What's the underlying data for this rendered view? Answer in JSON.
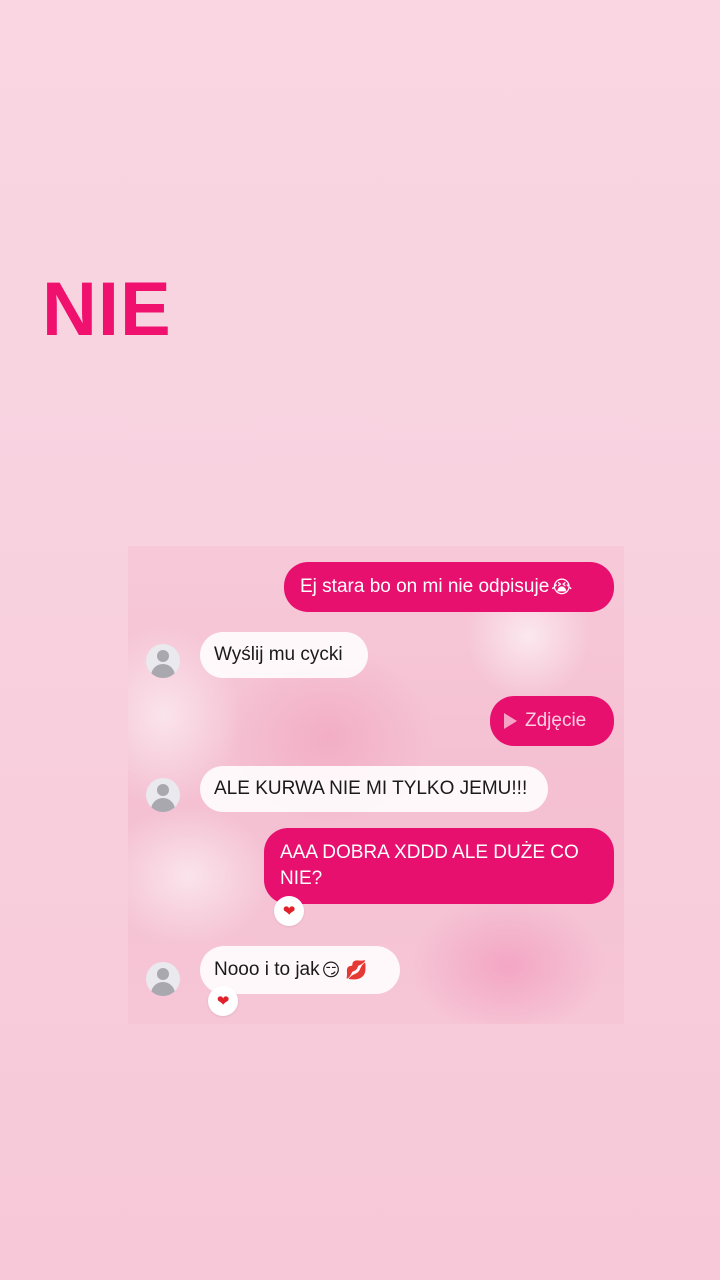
{
  "headline": "NIE",
  "messages": [
    {
      "text": "Ej stara bo on mi nie odpisuje",
      "emoji": "😭"
    },
    {
      "text": "Wyślij mu cycki"
    },
    {
      "text": "Zdjęcie"
    },
    {
      "text": "ALE KURWA NIE MI TYLKO JEMU!!!"
    },
    {
      "text_line1": "AAA DOBRA XDDD ALE DUŻE CO",
      "text_line2": "NIE?",
      "reaction": "❤"
    },
    {
      "text": "Nooo i to jak",
      "emoji": "😏 💋",
      "reaction": "❤"
    }
  ],
  "colors": {
    "accent": "#e8106f",
    "headline": "#f0106e",
    "background": "#f8d2df"
  },
  "icons": [
    "avatar-placeholder-icon",
    "play-icon",
    "heart-reaction-icon"
  ]
}
